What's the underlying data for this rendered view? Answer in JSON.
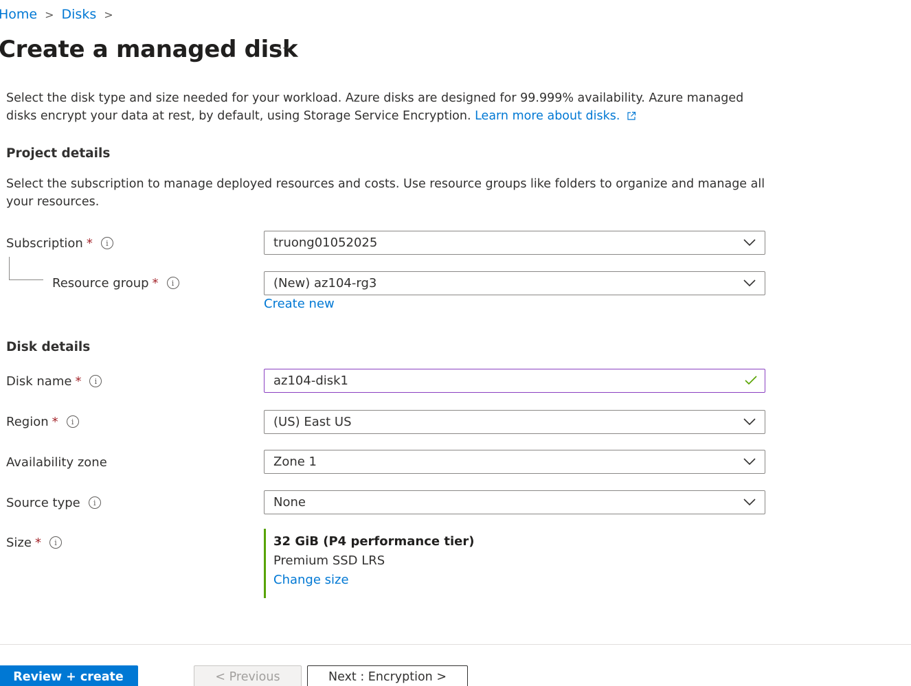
{
  "breadcrumb": {
    "home": "Home",
    "disks": "Disks",
    "separator": ">"
  },
  "page": {
    "title": "Create a managed disk",
    "more": "···"
  },
  "intro": {
    "text": "Select the disk type and size needed for your workload. Azure disks are designed for 99.999% availability. Azure managed disks encrypt your data at rest, by default, using Storage Service Encryption. ",
    "link": "Learn more about disks."
  },
  "project": {
    "heading": "Project details",
    "description": "Select the subscription to manage deployed resources and costs. Use resource groups like folders to organize and manage all your resources.",
    "subscription_label": "Subscription",
    "subscription_value": "truong01052025",
    "resource_group_label": "Resource group",
    "resource_group_value": "(New) az104-rg3",
    "create_new": "Create new"
  },
  "disk": {
    "heading": "Disk details",
    "name_label": "Disk name",
    "name_value": "az104-disk1",
    "region_label": "Region",
    "region_value": "(US) East US",
    "zone_label": "Availability zone",
    "zone_value": "Zone 1",
    "source_label": "Source type",
    "source_value": "None",
    "size_label": "Size",
    "size_value": "32 GiB (P4 performance tier)",
    "size_sku": "Premium SSD LRS",
    "change_size": "Change size"
  },
  "footer": {
    "review_create": "Review + create",
    "previous": "< Previous",
    "next": "Next : Encryption >"
  },
  "colors": {
    "accent": "#0078d4",
    "required": "#a4262c",
    "valid": "#57a300",
    "focus_border": "#8a3fc1"
  }
}
